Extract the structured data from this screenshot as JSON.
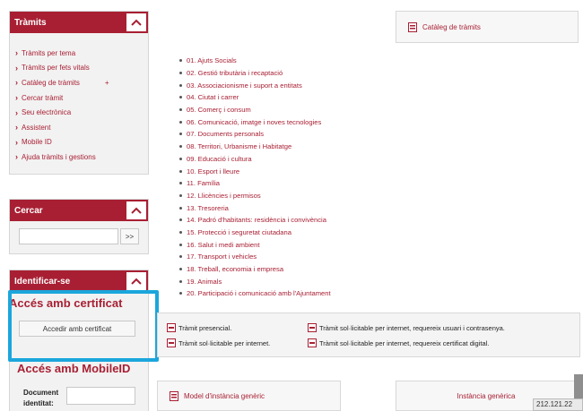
{
  "sidebar": {
    "tramits_panel": {
      "title": "Tràmits",
      "items": [
        {
          "label": "Tràmits per tema"
        },
        {
          "label": "Tràmits per fets vitals"
        },
        {
          "label": "Catàleg de tràmits",
          "extra": "+"
        },
        {
          "label": "Cercar tràmit"
        },
        {
          "label": "Seu electrònica"
        },
        {
          "label": "Assistent"
        },
        {
          "label": "Mobile ID"
        },
        {
          "label": "Ajuda tràmits i gestions"
        }
      ]
    },
    "cercar_panel": {
      "title": "Cercar",
      "search_value": "",
      "go_label": ">>"
    },
    "identificar_panel": {
      "title": "Identificar-se",
      "cert_heading": "Accés amb certificat",
      "cert_button": "Accedir amb certificat",
      "mobile_heading": "Accés amb MobileID",
      "document_label": "Document identitat:",
      "document_value": ""
    }
  },
  "catalog_link": "Catàleg de tràmits",
  "topics": [
    "01. Ajuts Socials",
    "02. Gestió tributària i recaptació",
    "03. Associacionisme i suport a entitats",
    "04. Ciutat i carrer",
    "05. Comerç i consum",
    "06. Comunicació, imatge i noves tecnologies",
    "07. Documents personals",
    "08. Territori, Urbanisme i Habitatge",
    "09. Educació i cultura",
    "10. Esport i lleure",
    "11. Família",
    "12. Llicències i permisos",
    "13. Tresoreria",
    "14. Padró d'habitants: residència i convivència",
    "15. Protecció i seguretat ciutadana",
    "16. Salut i medi ambient",
    "17. Transport i vehicles",
    "18. Treball, economia i empresa",
    "19. Animals",
    "20. Participació i comunicació amb l'Ajuntament"
  ],
  "legend": {
    "presencial": "Tràmit presencial.",
    "internet": "Tràmit sol·licitable per internet.",
    "user_pass": "Tràmit sol·licitable per internet, requereix usuari i contrasenya.",
    "certificate": "Tràmit sol·licitable per internet, requereix certificat digital."
  },
  "model_link": "Model d'instància genèric",
  "instancia_link": "Instància genèrica",
  "ip_text": "212.121.22",
  "colors": {
    "brand": "#a81f33",
    "highlight": "#1ba6dc"
  }
}
